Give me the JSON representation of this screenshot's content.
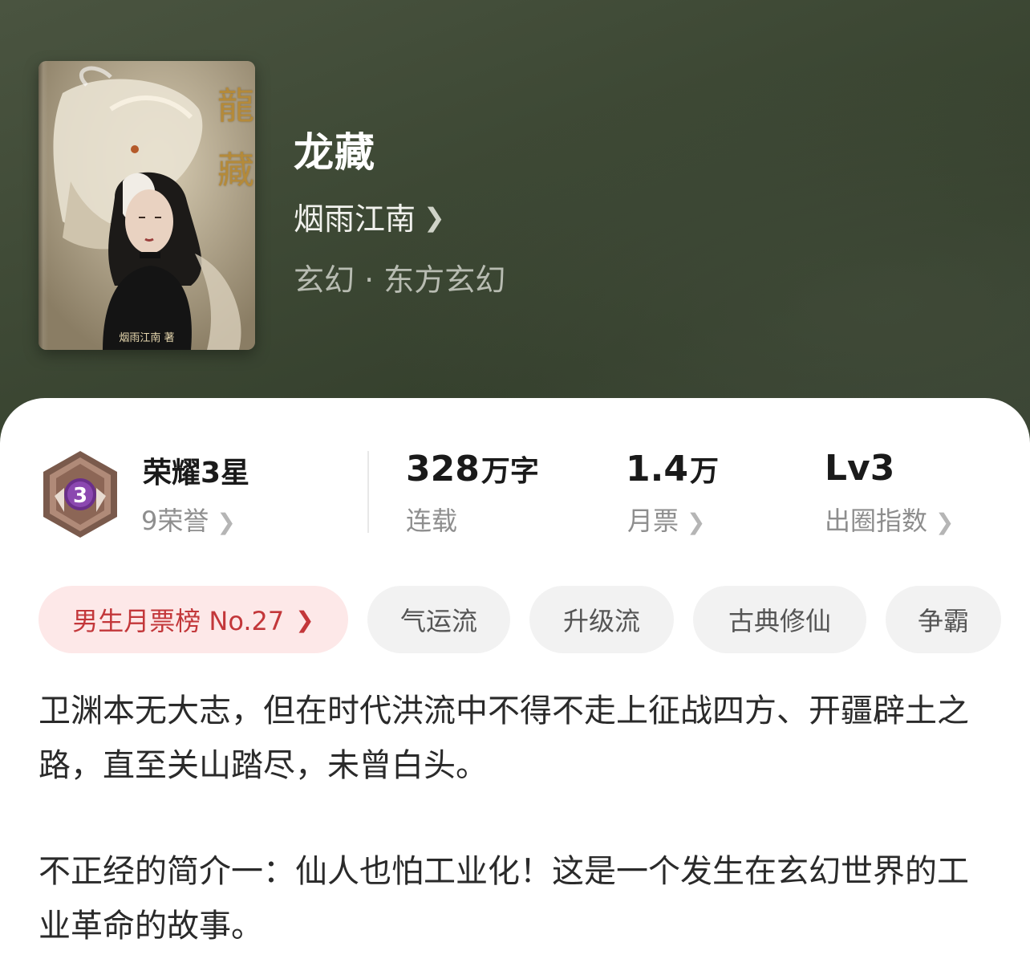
{
  "book": {
    "title": "龙藏",
    "author": "烟雨江南",
    "genre": "玄幻 · 东方玄幻",
    "cover": {
      "calligraphy_top": "龍",
      "calligraphy_bottom": "藏",
      "signature": "烟雨江南 著"
    }
  },
  "stats": {
    "honor": {
      "title": "荣耀3星",
      "sub": "9荣誉",
      "medal_level": "3"
    },
    "words": {
      "value": "328",
      "unit": "万字",
      "label": "连载"
    },
    "tickets": {
      "value": "1.4",
      "unit": "万",
      "label": "月票"
    },
    "index": {
      "value": "Lv3",
      "label": "出圈指数"
    }
  },
  "tags": {
    "rank": "男生月票榜 No.27",
    "items": [
      "气运流",
      "升级流",
      "古典修仙",
      "争霸"
    ]
  },
  "intro": {
    "p1": "卫渊本无大志，但在时代洪流中不得不走上征战四方、开疆辟土之路，直至关山踏尽，未曾白头。",
    "p2": "不正经的简介一：仙人也怕工业化！这是一个发生在玄幻世界的工业革命的故事。"
  },
  "colors": {
    "hero_bg": "#3f4a36",
    "rank_tag_bg": "#fde8e8",
    "rank_tag_text": "#c3373a",
    "medal_badge": "#6a2f8a"
  }
}
